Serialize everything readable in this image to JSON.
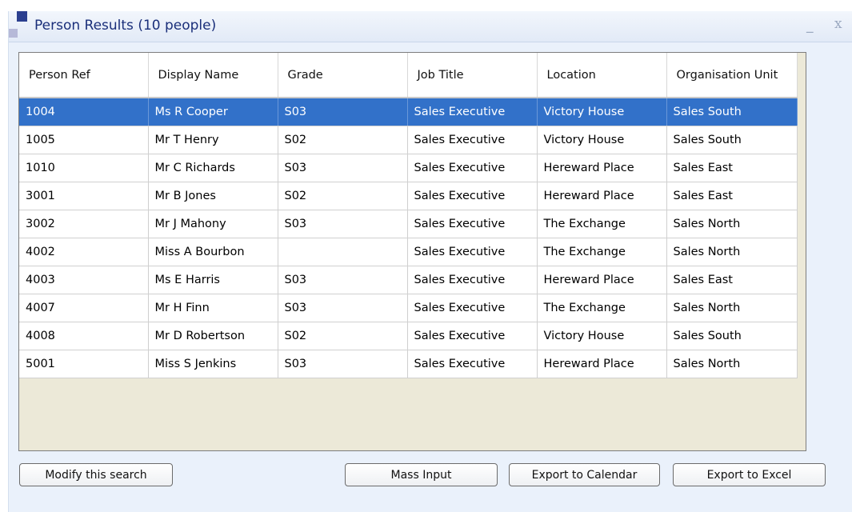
{
  "window": {
    "title": "Person Results (10 people)",
    "minimize_glyph": "_",
    "close_glyph": "x"
  },
  "table": {
    "headers": [
      "Person Ref",
      "Display Name",
      "Grade",
      "Job Title",
      "Location",
      "Organisation Unit"
    ],
    "rows": [
      [
        "1004",
        "Ms R Cooper",
        "S03",
        "Sales Executive",
        "Victory House",
        "Sales South"
      ],
      [
        "1005",
        "Mr T Henry",
        "S02",
        "Sales Executive",
        "Victory House",
        "Sales South"
      ],
      [
        "1010",
        "Mr C Richards",
        "S03",
        "Sales Executive",
        "Hereward Place",
        "Sales East"
      ],
      [
        "3001",
        "Mr B Jones",
        "S02",
        "Sales Executive",
        "Hereward Place",
        "Sales East"
      ],
      [
        "3002",
        "Mr J Mahony",
        "S03",
        "Sales Executive",
        "The Exchange",
        "Sales North"
      ],
      [
        "4002",
        "Miss A Bourbon",
        "",
        "Sales Executive",
        "The Exchange",
        "Sales North"
      ],
      [
        "4003",
        "Ms E Harris",
        "S03",
        "Sales Executive",
        "Hereward Place",
        "Sales East"
      ],
      [
        "4007",
        "Mr H Finn",
        "S03",
        "Sales Executive",
        "The Exchange",
        "Sales North"
      ],
      [
        "4008",
        "Mr D Robertson",
        "S02",
        "Sales Executive",
        "Victory House",
        "Sales South"
      ],
      [
        "5001",
        "Miss S Jenkins",
        "S03",
        "Sales Executive",
        "Hereward Place",
        "Sales North"
      ]
    ],
    "selected_row": 0
  },
  "buttons": {
    "modify": "Modify this search",
    "mass_input": "Mass Input",
    "export_calendar": "Export to Calendar",
    "export_excel": "Export to Excel"
  },
  "colors": {
    "selection": "#3271c9",
    "title_text": "#1a2f7a",
    "panel_bg": "#eaf1fb"
  },
  "icons": {
    "logo": "squares-logo-icon"
  }
}
